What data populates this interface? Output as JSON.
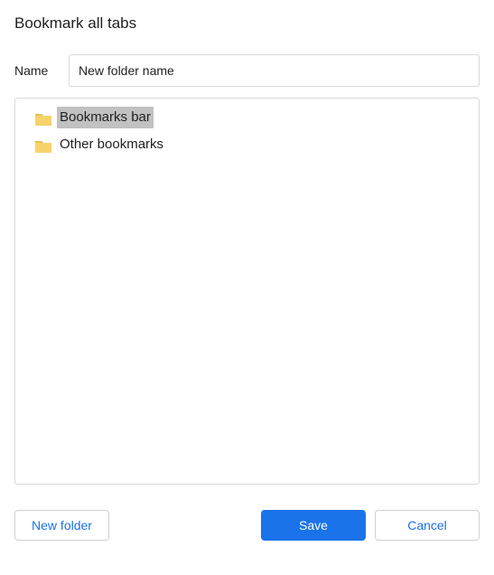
{
  "dialog": {
    "title": "Bookmark all tabs"
  },
  "name_field": {
    "label": "Name",
    "value": "New folder name"
  },
  "folders": [
    {
      "label": "Bookmarks bar",
      "selected": true
    },
    {
      "label": "Other bookmarks",
      "selected": false
    }
  ],
  "buttons": {
    "new_folder": "New folder",
    "save": "Save",
    "cancel": "Cancel"
  },
  "colors": {
    "primary": "#1a73e8",
    "folder_fill": "#f6d36b",
    "folder_tab": "#e8c14f"
  }
}
